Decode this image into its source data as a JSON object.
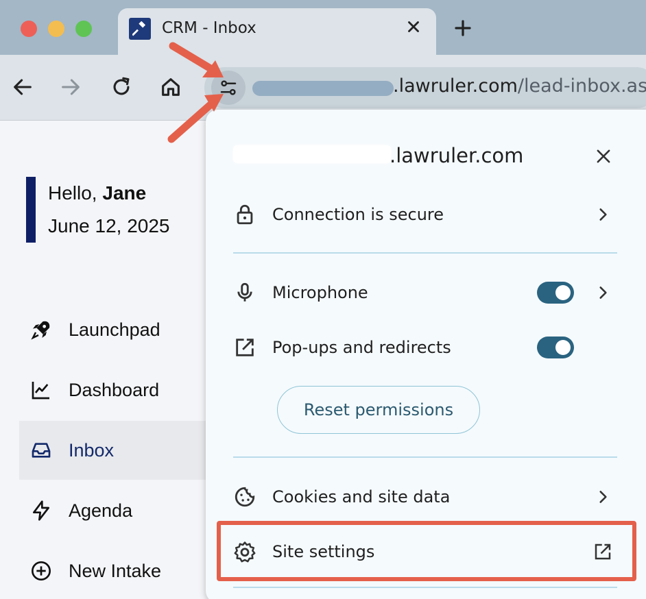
{
  "browser": {
    "tab_title": "CRM - Inbox",
    "new_tab_symbol": "+",
    "close_tab_symbol": "×",
    "url_host": ".lawruler.com",
    "url_path": "/lead-inbox.asp",
    "icons": [
      "back-icon",
      "forward-icon",
      "reload-icon",
      "home-icon",
      "site-info-icon"
    ]
  },
  "sidebar": {
    "greeting_prefix": "Hello, ",
    "greeting_name": "Jane",
    "date": "June 12, 2025",
    "items": [
      {
        "label": "Launchpad",
        "icon": "rocket-icon"
      },
      {
        "label": "Dashboard",
        "icon": "chart-line-icon"
      },
      {
        "label": "Inbox",
        "icon": "inbox-icon",
        "active": true
      },
      {
        "label": "Agenda",
        "icon": "lightning-icon"
      },
      {
        "label": "New Intake",
        "icon": "plus-circle-icon"
      }
    ]
  },
  "popup": {
    "domain": ".lawruler.com",
    "connection": "Connection is secure",
    "microphone": "Microphone",
    "popups": "Pop-ups and redirects",
    "reset": "Reset permissions",
    "cookies": "Cookies and site data",
    "site_settings": "Site settings",
    "microphone_enabled": true,
    "popups_enabled": true
  },
  "colors": {
    "accent_navy": "#0f1f66",
    "toggle_on": "#2a6380",
    "annotation_red": "#e4604b"
  }
}
